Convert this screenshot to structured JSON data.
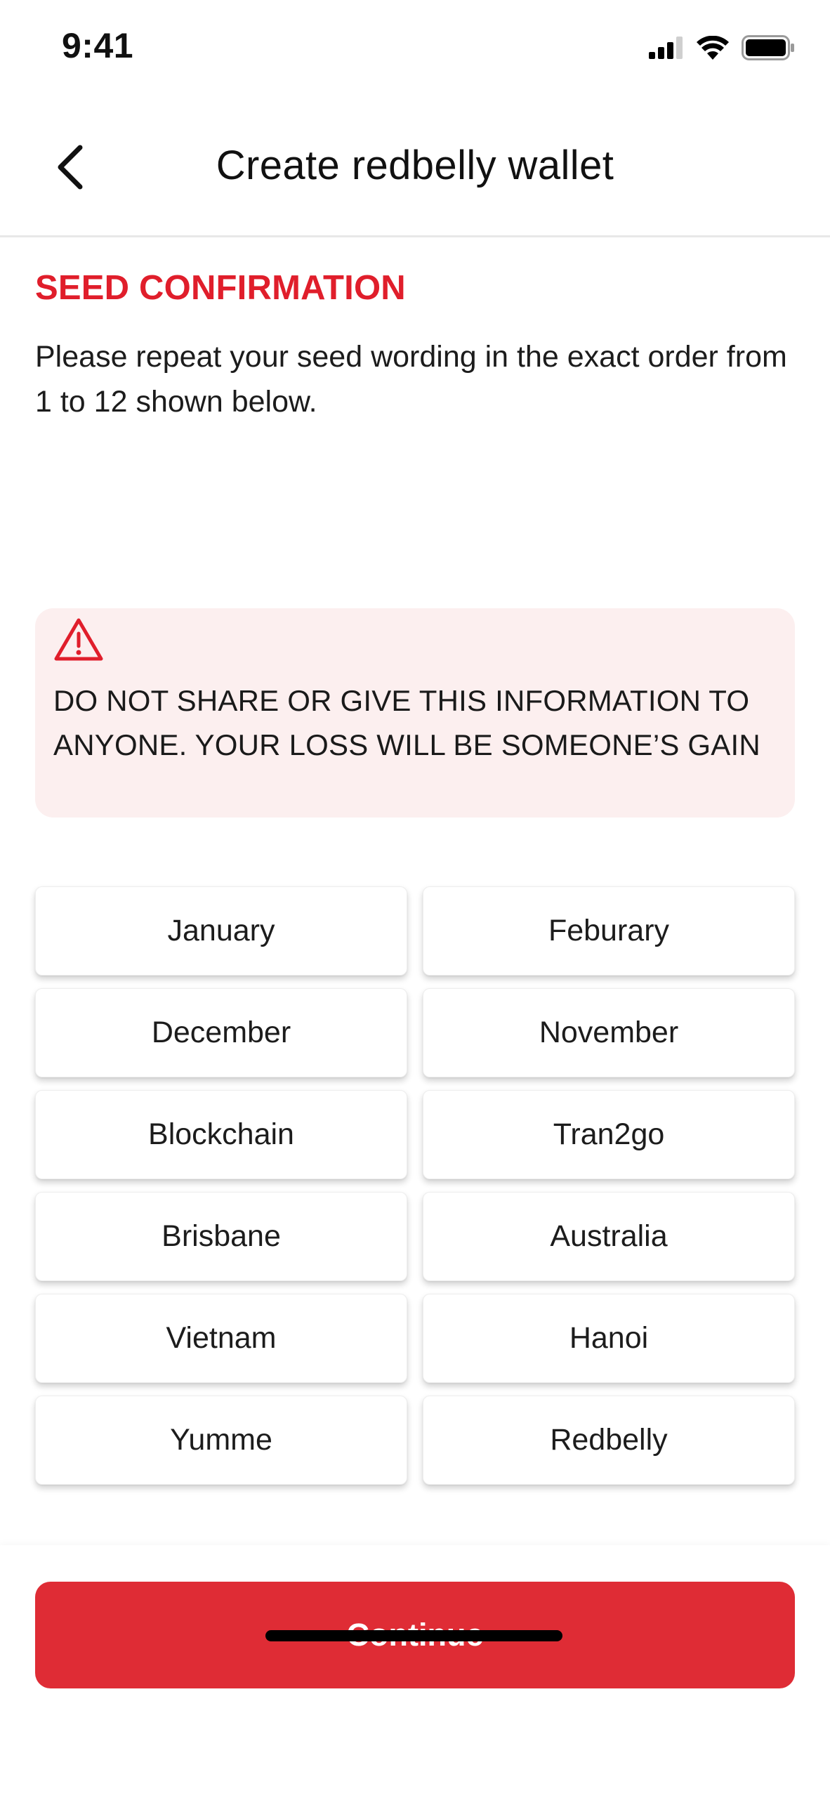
{
  "status_bar": {
    "time": "9:41",
    "icons": [
      "signal-icon",
      "wifi-icon",
      "battery-icon"
    ]
  },
  "header": {
    "back_icon": "chevron-left-icon",
    "title": "Create redbelly wallet"
  },
  "main": {
    "section_title": "SEED CONFIRMATION",
    "instructions": "Please repeat your seed wording in the exact order from 1 to 12 shown below.",
    "warning": {
      "icon": "warning-triangle-icon",
      "text": "DO NOT SHARE OR GIVE THIS INFORMATION TO ANYONE.  YOUR LOSS WILL BE SOMEONE’S GAIN"
    },
    "seed_words": [
      "January",
      "Feburary",
      "December",
      "November",
      "Blockchain",
      "Tran2go",
      "Brisbane",
      "Australia",
      "Vietnam",
      "Hanoi",
      "Yumme",
      "Redbelly"
    ]
  },
  "footer": {
    "continue_label": "Continue"
  },
  "colors": {
    "accent": "#e01e2b",
    "button": "#df2c35",
    "warning_bg": "#fcefef"
  }
}
